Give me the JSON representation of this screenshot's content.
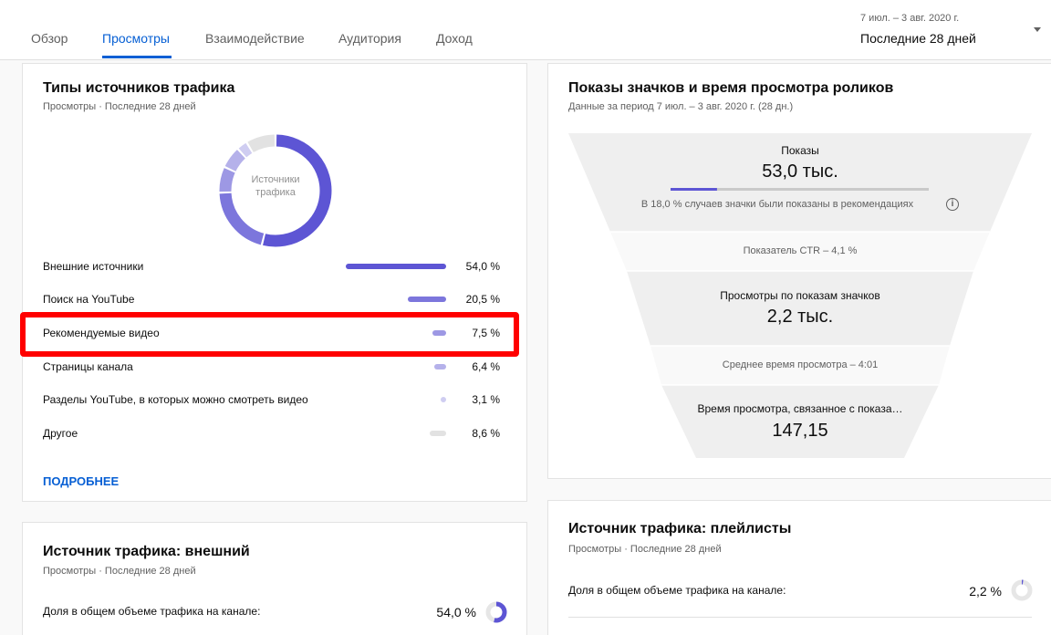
{
  "tabs": [
    {
      "label": "Обзор"
    },
    {
      "label": "Просмотры"
    },
    {
      "label": "Взаимодействие"
    },
    {
      "label": "Аудитория"
    },
    {
      "label": "Доход"
    }
  ],
  "active_tab": "Просмотры",
  "date_range": {
    "dates": "7 июл. – 3 авг. 2020 г.",
    "label": "Последние 28 дней"
  },
  "traffic_types": {
    "title": "Типы источников трафика",
    "subtitle": "Просмотры · Последние 28 дней",
    "donut_label": "Источники трафика",
    "rows": [
      {
        "name": "Внешние источники",
        "value": 54.0,
        "pct": "54,0 %",
        "color": "#5d55d4"
      },
      {
        "name": "Поиск на YouTube",
        "value": 20.5,
        "pct": "20,5 %",
        "color": "#7c76dc"
      },
      {
        "name": "Рекомендуемые видео",
        "value": 7.5,
        "pct": "7,5 %",
        "color": "#9d98e4"
      },
      {
        "name": "Страницы канала",
        "value": 6.4,
        "pct": "6,4 %",
        "color": "#b5b1ea"
      },
      {
        "name": "Разделы YouTube, в которых можно смотреть видео",
        "value": 3.1,
        "pct": "3,1 %",
        "color": "#cfcdf1"
      },
      {
        "name": "Другое",
        "value": 8.6,
        "pct": "8,6 %",
        "color": "#e2e2e2"
      }
    ],
    "highlighted_row": "Рекомендуемые видео",
    "more_link": "ПОДРОБНЕЕ"
  },
  "funnel": {
    "title": "Показы значков и время просмотра роликов",
    "subtitle": "Данные за период 7 июл. – 3 авг. 2020 г. (28 дн.)",
    "impressions_label": "Показы",
    "impressions_value": "53,0 тыс.",
    "impressions_progress": 0.18,
    "impressions_note": "В 18,0 % случаев значки были показаны в рекомендациях",
    "ctr": "Показатель CTR – 4,1 %",
    "views_label": "Просмотры по показам значков",
    "views_value": "2,2 тыс.",
    "avg_time": "Среднее время просмотра – 4:01",
    "watch_label": "Время просмотра, связанное с показа…",
    "watch_value": "147,15",
    "colors": {
      "dark": "#efefef",
      "light": "#f9f9f9",
      "accent": "#5d55d4",
      "track": "#c9c9c9"
    }
  },
  "external": {
    "title": "Источник трафика: внешний",
    "subtitle": "Просмотры · Последние 28 дней",
    "share_label": "Доля в общем объеме трафика на канале:",
    "share_value": "54,0 %",
    "share_fraction": 0.54
  },
  "playlists": {
    "title": "Источник трафика: плейлисты",
    "subtitle": "Просмотры · Последние 28 дней",
    "share_label": "Доля в общем объеме трафика на канале:",
    "share_value": "2,2 %",
    "share_fraction": 0.022
  }
}
